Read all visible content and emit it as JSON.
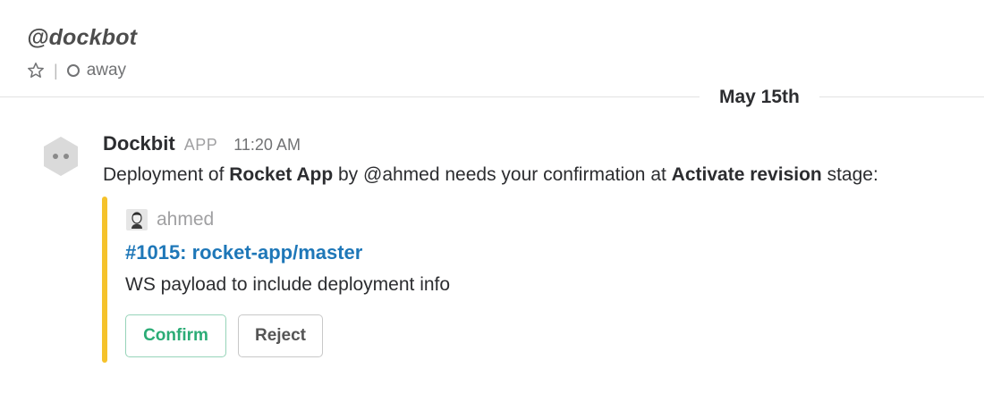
{
  "channel": {
    "title": "@dockbot",
    "status": "away",
    "star_icon": "star-outline-icon",
    "presence_icon": "presence-away-icon"
  },
  "date_divider": {
    "label": "May 15th"
  },
  "message": {
    "sender": "Dockbit",
    "badge": "APP",
    "time": "11:20 AM",
    "avatar_icon": "robot-avatar-icon",
    "body": {
      "prefix": "Deployment of ",
      "app_name": "Rocket App",
      "middle": " by @ahmed needs your confirmation at ",
      "stage": "Activate revision",
      "suffix": " stage:"
    },
    "attachment": {
      "color": "#f5c22b",
      "author": "ahmed",
      "author_icon": "user-avatar-icon",
      "title": "#1015: rocket-app/master",
      "text": "WS payload to include deployment info",
      "actions": [
        {
          "label": "Confirm",
          "color": "#2bac76"
        },
        {
          "label": "Reject",
          "color": "#555555"
        }
      ]
    }
  }
}
